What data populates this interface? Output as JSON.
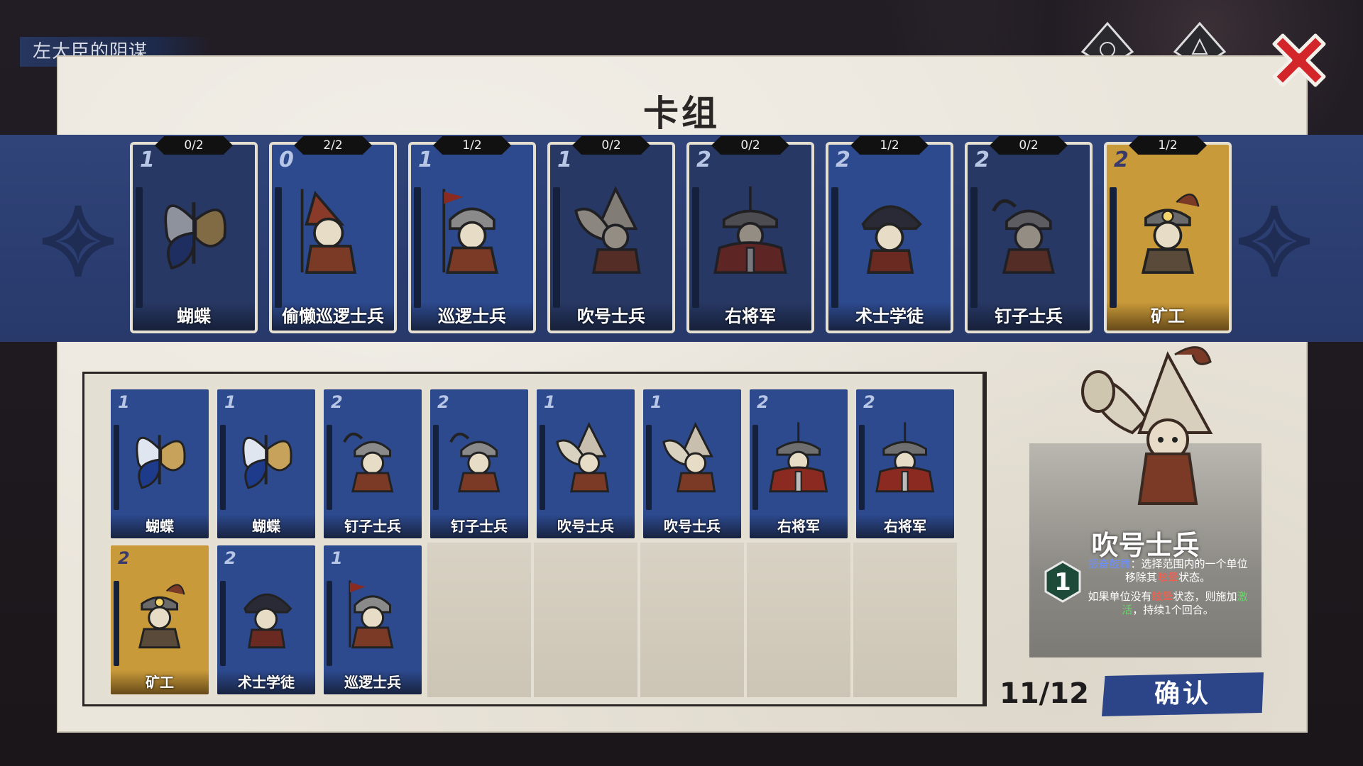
{
  "chapter_title": "左大臣的阴谋",
  "deck_title": "卡组",
  "collection": [
    {
      "name": "蝴蝶",
      "cost": "1",
      "count": "0/2",
      "color": "blue",
      "dim": true,
      "art": "butterfly-icon"
    },
    {
      "name": "偷懒巡逻士兵",
      "cost": "0",
      "count": "2/2",
      "color": "blue",
      "dim": false,
      "art": "lazy-soldier-icon"
    },
    {
      "name": "巡逻士兵",
      "cost": "1",
      "count": "1/2",
      "color": "blue",
      "dim": false,
      "art": "patrol-soldier-icon"
    },
    {
      "name": "吹号士兵",
      "cost": "1",
      "count": "0/2",
      "color": "blue",
      "dim": true,
      "art": "horn-soldier-icon"
    },
    {
      "name": "右将军",
      "cost": "2",
      "count": "0/2",
      "color": "blue",
      "dim": true,
      "art": "general-icon"
    },
    {
      "name": "术士学徒",
      "cost": "2",
      "count": "1/2",
      "color": "blue",
      "dim": false,
      "art": "apprentice-icon"
    },
    {
      "name": "钉子士兵",
      "cost": "2",
      "count": "0/2",
      "color": "blue",
      "dim": true,
      "art": "nail-soldier-icon"
    },
    {
      "name": "矿工",
      "cost": "2",
      "count": "1/2",
      "color": "gold",
      "dim": false,
      "art": "miner-icon"
    }
  ],
  "deck": [
    {
      "name": "蝴蝶",
      "cost": "1",
      "color": "blue",
      "art": "butterfly-icon"
    },
    {
      "name": "蝴蝶",
      "cost": "1",
      "color": "blue",
      "art": "butterfly-icon"
    },
    {
      "name": "钉子士兵",
      "cost": "2",
      "color": "blue",
      "art": "nail-soldier-icon"
    },
    {
      "name": "钉子士兵",
      "cost": "2",
      "color": "blue",
      "art": "nail-soldier-icon"
    },
    {
      "name": "吹号士兵",
      "cost": "1",
      "color": "blue",
      "art": "horn-soldier-icon"
    },
    {
      "name": "吹号士兵",
      "cost": "1",
      "color": "blue",
      "art": "horn-soldier-icon"
    },
    {
      "name": "右将军",
      "cost": "2",
      "color": "blue",
      "art": "general-icon"
    },
    {
      "name": "右将军",
      "cost": "2",
      "color": "blue",
      "art": "general-icon"
    },
    {
      "name": "矿工",
      "cost": "2",
      "color": "gold",
      "art": "miner-icon"
    },
    {
      "name": "术士学徒",
      "cost": "2",
      "color": "blue",
      "art": "apprentice-icon"
    },
    {
      "name": "巡逻士兵",
      "cost": "1",
      "color": "blue",
      "art": "patrol-soldier-icon"
    }
  ],
  "detail": {
    "name": "吹号士兵",
    "cost": "1",
    "line1_kw": "振奋鼓舞",
    "line1_a": "：选择范围内的一个单位移除其",
    "line1_kw2": "眩晕",
    "line1_b": "状态。",
    "line2_a": "如果单位没有",
    "line2_kw": "眩晕",
    "line2_b": "状态，则施加",
    "line2_kw2": "激活",
    "line2_c": "，持续1个回合。"
  },
  "deck_count": "11/12",
  "confirm_label": "确认",
  "colors": {
    "band": "#2c3e6d",
    "card_blue": "#2d4a8f",
    "card_gold": "#c99a3a",
    "close": "#d2262a"
  }
}
